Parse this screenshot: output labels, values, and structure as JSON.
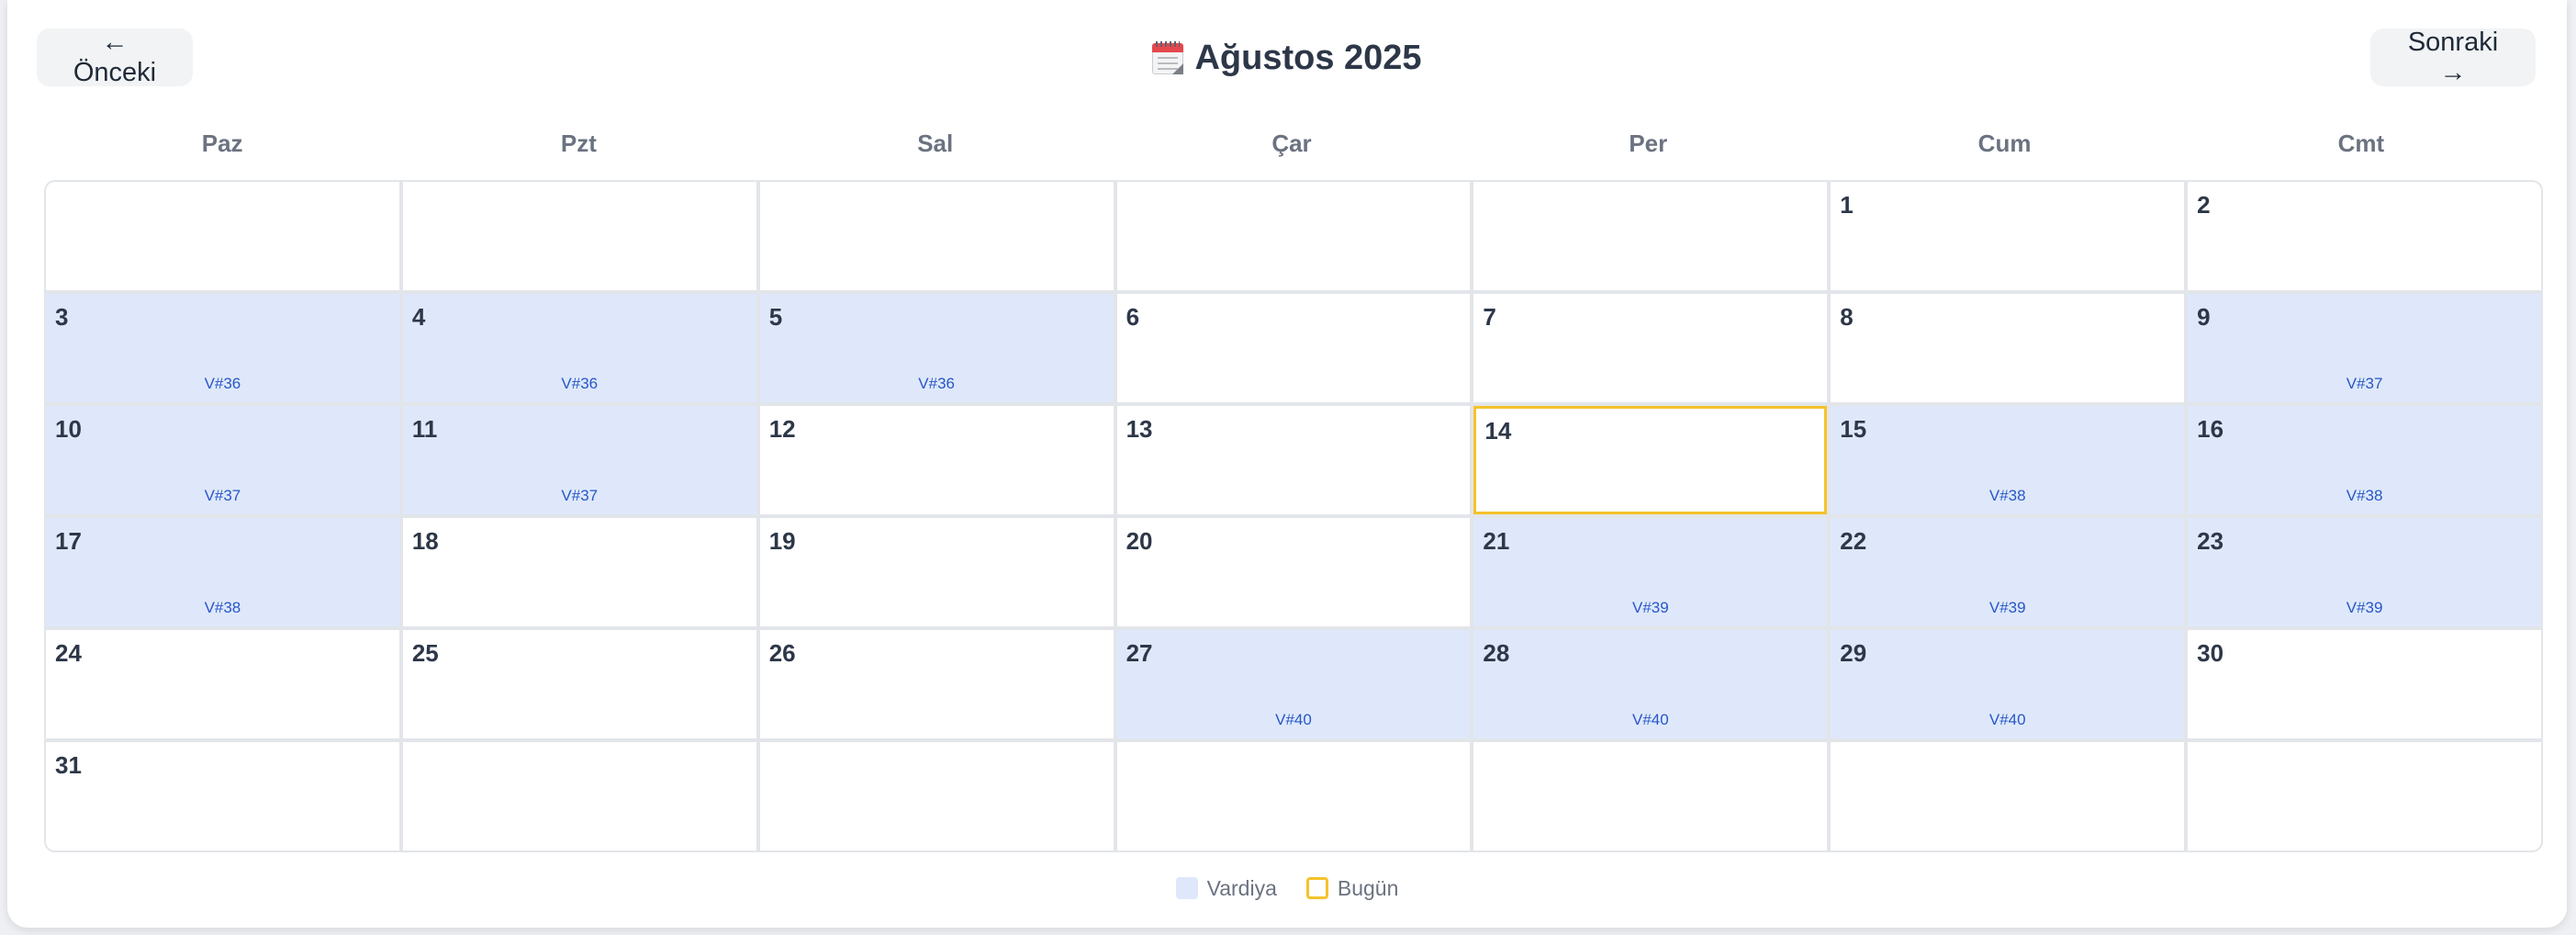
{
  "header": {
    "prev_label": "← Önceki",
    "next_label": "Sonraki →",
    "title": "Ağustos 2025",
    "title_icon": "calendar-icon"
  },
  "weekdays": [
    "Paz",
    "Pzt",
    "Sal",
    "Çar",
    "Per",
    "Cum",
    "Cmt"
  ],
  "weeks": [
    [
      {
        "day": "",
        "shift": ""
      },
      {
        "day": "",
        "shift": ""
      },
      {
        "day": "",
        "shift": ""
      },
      {
        "day": "",
        "shift": ""
      },
      {
        "day": "",
        "shift": ""
      },
      {
        "day": "1",
        "shift": ""
      },
      {
        "day": "2",
        "shift": ""
      }
    ],
    [
      {
        "day": "3",
        "shift": "V#36"
      },
      {
        "day": "4",
        "shift": "V#36"
      },
      {
        "day": "5",
        "shift": "V#36"
      },
      {
        "day": "6",
        "shift": ""
      },
      {
        "day": "7",
        "shift": ""
      },
      {
        "day": "8",
        "shift": ""
      },
      {
        "day": "9",
        "shift": "V#37"
      }
    ],
    [
      {
        "day": "10",
        "shift": "V#37"
      },
      {
        "day": "11",
        "shift": "V#37"
      },
      {
        "day": "12",
        "shift": ""
      },
      {
        "day": "13",
        "shift": ""
      },
      {
        "day": "14",
        "shift": "",
        "today": true
      },
      {
        "day": "15",
        "shift": "V#38"
      },
      {
        "day": "16",
        "shift": "V#38"
      }
    ],
    [
      {
        "day": "17",
        "shift": "V#38"
      },
      {
        "day": "18",
        "shift": ""
      },
      {
        "day": "19",
        "shift": ""
      },
      {
        "day": "20",
        "shift": ""
      },
      {
        "day": "21",
        "shift": "V#39"
      },
      {
        "day": "22",
        "shift": "V#39"
      },
      {
        "day": "23",
        "shift": "V#39"
      }
    ],
    [
      {
        "day": "24",
        "shift": ""
      },
      {
        "day": "25",
        "shift": ""
      },
      {
        "day": "26",
        "shift": ""
      },
      {
        "day": "27",
        "shift": "V#40"
      },
      {
        "day": "28",
        "shift": "V#40"
      },
      {
        "day": "29",
        "shift": "V#40"
      },
      {
        "day": "30",
        "shift": ""
      }
    ],
    [
      {
        "day": "31",
        "shift": ""
      },
      {
        "day": "",
        "shift": ""
      },
      {
        "day": "",
        "shift": ""
      },
      {
        "day": "",
        "shift": ""
      },
      {
        "day": "",
        "shift": ""
      },
      {
        "day": "",
        "shift": ""
      },
      {
        "day": "",
        "shift": ""
      }
    ]
  ],
  "legend": {
    "shift_label": "Vardiya",
    "today_label": "Bugün"
  },
  "colors": {
    "shift_bg": "#dfe8fa",
    "shift_text": "#2657c8",
    "today_border": "#f5c22b"
  }
}
